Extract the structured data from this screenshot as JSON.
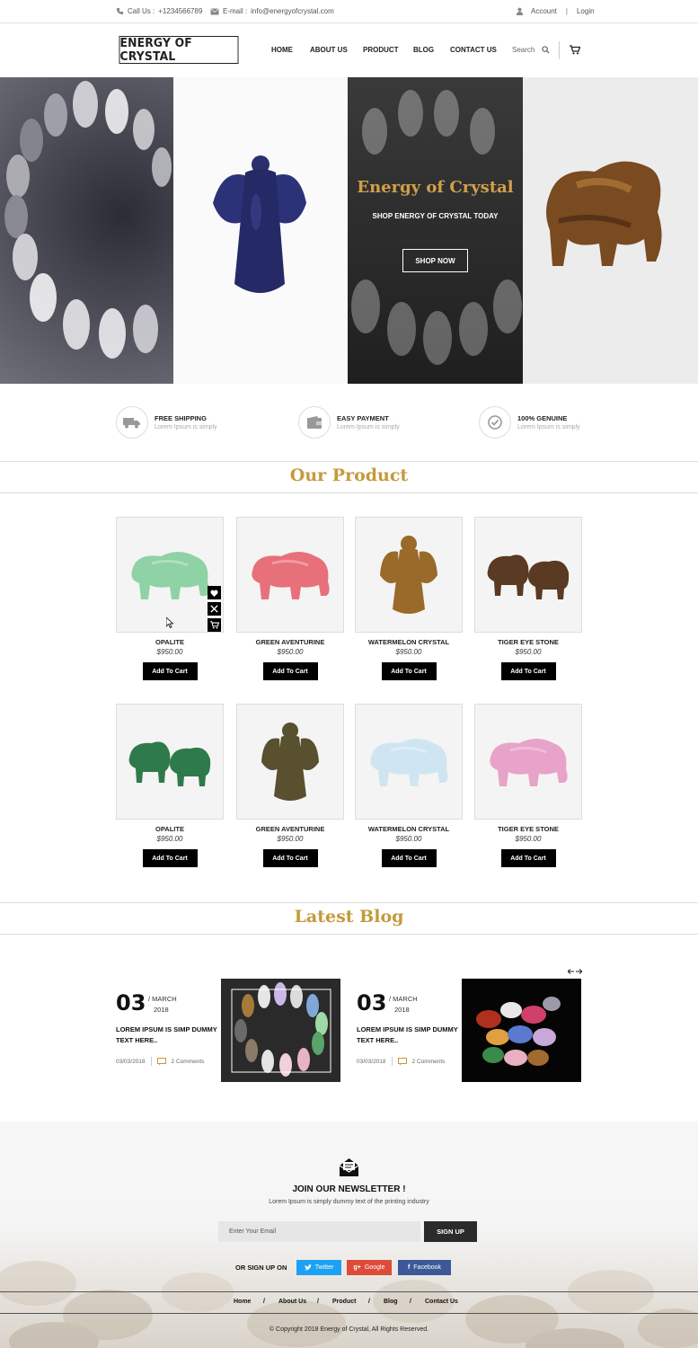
{
  "topbar": {
    "call_label": "Call Us :",
    "phone": "+1234566789",
    "email_label": "E-mail :",
    "email": "info@energyofcrystal.com",
    "account": "Account",
    "separator": "|",
    "login": "Login"
  },
  "header": {
    "logo": "ENERGY OF CRYSTAL",
    "nav": [
      "HOME",
      "ABOUT US",
      "PRODUCT",
      "BLOG",
      "CONTACT US"
    ],
    "search_placeholder": "Search"
  },
  "hero": {
    "title": "Energy of Crystal",
    "subtitle": "SHOP ENERGY OF CRYSTAL TODAY",
    "button": "SHOP NOW"
  },
  "features": [
    {
      "title": "FREE SHIPPING",
      "subtitle": "Lorem Ipsum is simply",
      "icon": "truck-icon"
    },
    {
      "title": "EASY PAYMENT",
      "subtitle": "Lorem Ipsum is simply",
      "icon": "wallet-icon"
    },
    {
      "title": "100% GENUINE",
      "subtitle": "Lorem Ipsum is simply",
      "icon": "check-circle-icon"
    }
  ],
  "products_section": {
    "title": "Our Product",
    "cart_label": "Add To Cart",
    "items": [
      {
        "name": "OPALITE",
        "price": "$950.00",
        "color": "#8fd2a5"
      },
      {
        "name": "GREEN AVENTURINE",
        "price": "$950.00",
        "color": "#e8707a"
      },
      {
        "name": "WATERMELON CRYSTAL",
        "price": "$950.00",
        "color": "#9a6a2a"
      },
      {
        "name": "TIGER EYE STONE",
        "price": "$950.00",
        "color": "#5a3a22"
      },
      {
        "name": "OPALITE",
        "price": "$950.00",
        "color": "#2f7a4a"
      },
      {
        "name": "GREEN AVENTURINE",
        "price": "$950.00",
        "color": "#58502e"
      },
      {
        "name": "WATERMELON CRYSTAL",
        "price": "$950.00",
        "color": "#cfe6f2"
      },
      {
        "name": "TIGER EYE STONE",
        "price": "$950.00",
        "color": "#e8a3c8"
      }
    ]
  },
  "blog_section": {
    "title": "Latest Blog",
    "posts": [
      {
        "day": "03",
        "month": "/ MARCH",
        "year": "2018",
        "text": "LOREM IPSUM IS SIMP DUMMY TEXT HERE..",
        "date": "03/03/2018",
        "comments": "2 Comments"
      },
      {
        "day": "03",
        "month": "/ MARCH",
        "year": "2018",
        "text": "LOREM IPSUM IS SIMP DUMMY TEXT HERE..",
        "date": "03/03/2018",
        "comments": "2 Comments"
      }
    ]
  },
  "newsletter": {
    "title": "JOIN OUR NEWSLETTER !",
    "subtitle": "Lorem Ipsum is simply dummy text of the printing industry",
    "email_placeholder": "Enter Your Email",
    "button": "SIGN UP",
    "or_text": "OR SIGN UP ON",
    "twitter": "Twitter",
    "google": "Google",
    "facebook": "Facebook"
  },
  "footer": {
    "nav": [
      "Home",
      "About Us",
      "Product",
      "Blog",
      "Contact Us"
    ],
    "nav_separator": "/",
    "copyright": "© Copyright 2018 Energy of Crystal, All Rights Reserved."
  },
  "colors": {
    "accent": "#c49a3c",
    "hero_gold": "#d1a04b",
    "twitter": "#1da1f2",
    "google": "#dd4b39",
    "facebook": "#3b5998"
  }
}
